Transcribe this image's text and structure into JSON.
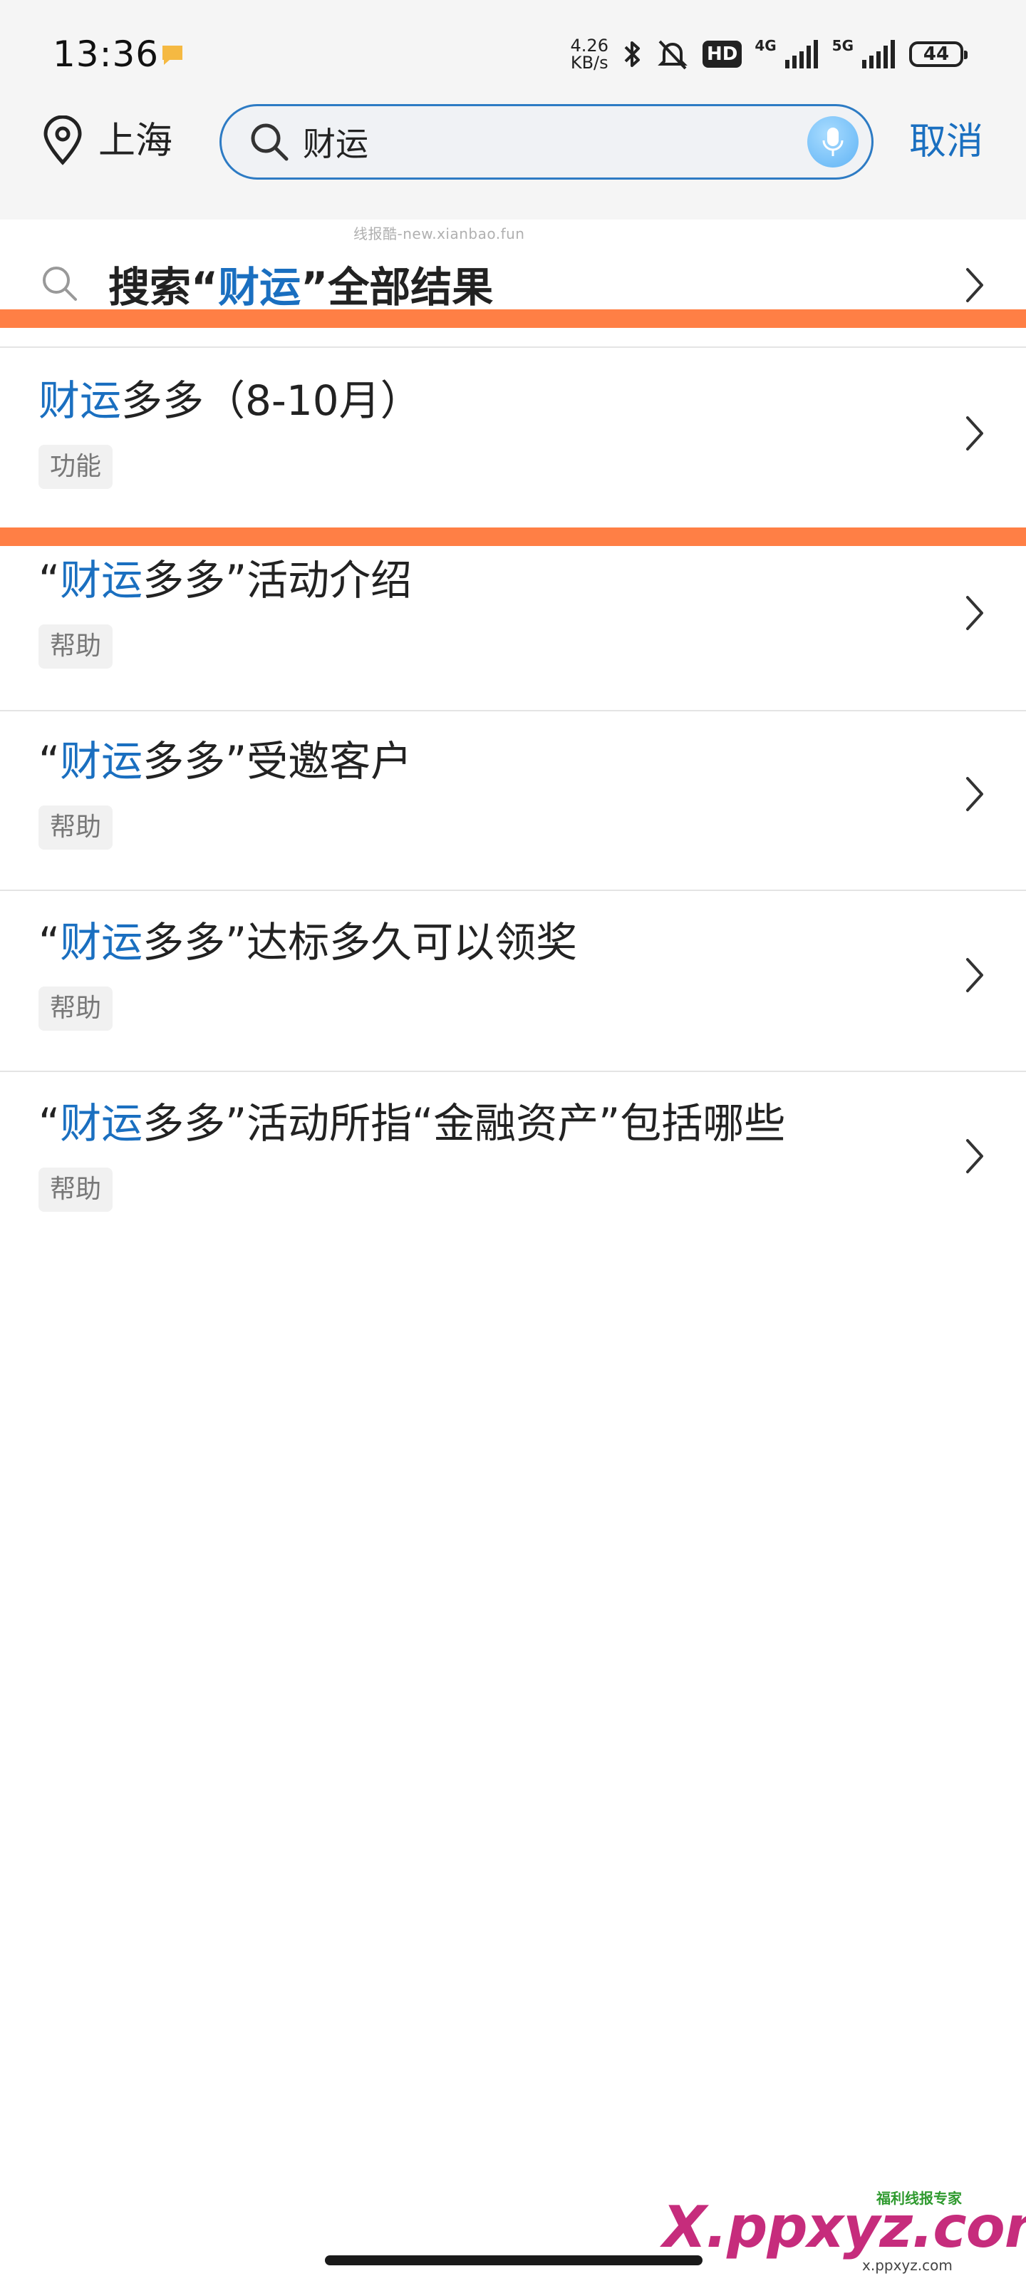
{
  "status_bar": {
    "time": "13:36",
    "net_speed_value": "4.26",
    "net_speed_unit": "KB/s",
    "hd_label": "HD",
    "sig1_label": "4G",
    "sig2_label": "5G",
    "battery": "44"
  },
  "header": {
    "location": "上海",
    "search_value": "财运",
    "cancel_label": "取消"
  },
  "watermark_top": "线报酷-new.xianbao.fun",
  "all_results": {
    "prefix": "搜索“",
    "keyword": "财运",
    "suffix": "”全部结果"
  },
  "results": [
    {
      "lead": "",
      "keyword": "财运",
      "rest": "多多（8-10月）",
      "tag": "功能"
    },
    {
      "lead": "“",
      "keyword": "财运",
      "rest": "多多”活动介绍",
      "tag": "帮助"
    },
    {
      "lead": "“",
      "keyword": "财运",
      "rest": "多多”受邀客户",
      "tag": "帮助"
    },
    {
      "lead": "“",
      "keyword": "财运",
      "rest": "多多”达标多久可以领奖",
      "tag": "帮助"
    },
    {
      "lead": "“",
      "keyword": "财运",
      "rest": "多多”活动所指“金融资产”包括哪些",
      "tag": "帮助"
    }
  ],
  "brand_watermark": {
    "main": "X.ppxyz.com",
    "small": "福利线报专家",
    "url": "x.ppxyz.com"
  },
  "colors": {
    "accent": "#1a6fc0",
    "orange_bar": "#ff7f45",
    "search_border": "#2d7bc4"
  }
}
